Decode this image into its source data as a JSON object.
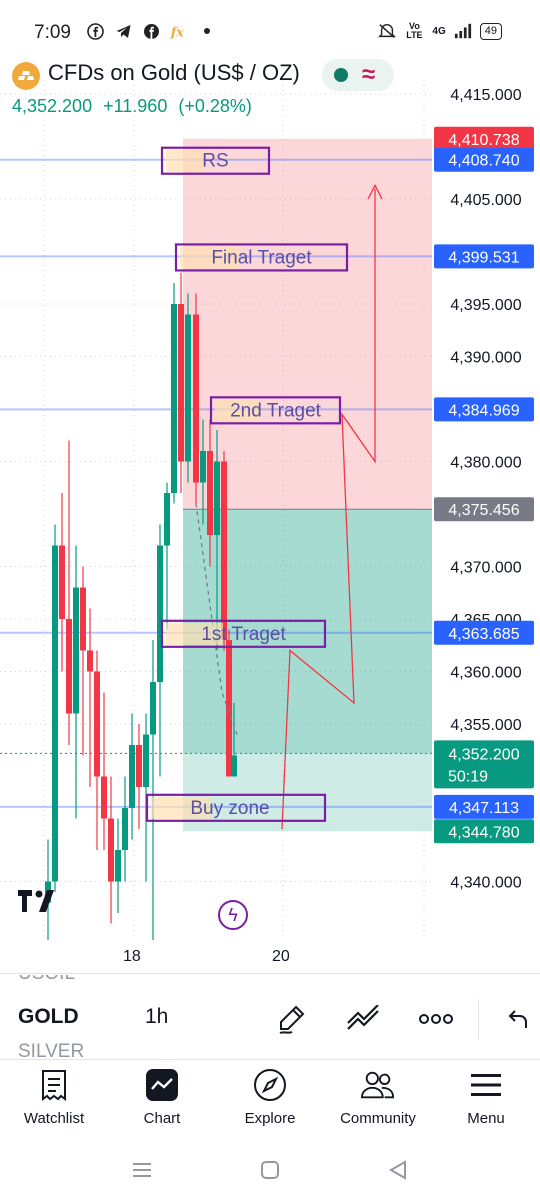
{
  "status_bar": {
    "time": "7:09",
    "battery": "49",
    "network": "4G",
    "volte": "Vo LTE"
  },
  "header": {
    "title": "CFDs on Gold (US$ / OZ)",
    "price": "4,352.200",
    "change": "+11.960",
    "change_pct": "(+0.28%)",
    "up_color": "#089981"
  },
  "chart": {
    "axis_ticks": [
      "4,415.000",
      "4,405.000",
      "4,395.000",
      "4,390.000",
      "4,380.000",
      "4,370.000",
      "4,365.000",
      "4,360.000",
      "4,355.000",
      "4,340.000"
    ],
    "axis_tick_values": [
      4415,
      4405,
      4395,
      4390,
      4380,
      4370,
      4365,
      4360,
      4355,
      4340
    ],
    "price_tags": [
      {
        "label": "4,410.738",
        "value": 4410.738,
        "color": "#f23645"
      },
      {
        "label": "4,408.740",
        "value": 4408.74,
        "color": "#2962ff"
      },
      {
        "label": "4,399.531",
        "value": 4399.531,
        "color": "#2962ff"
      },
      {
        "label": "4,384.969",
        "value": 4384.969,
        "color": "#2962ff"
      },
      {
        "label": "4,375.456",
        "value": 4375.456,
        "color": "#787b86"
      },
      {
        "label": "4,363.685",
        "value": 4363.685,
        "color": "#2962ff"
      },
      {
        "label": "4,347.113",
        "value": 4347.113,
        "color": "#2962ff"
      },
      {
        "label": "4,344.780",
        "value": 4344.78,
        "color": "#089981"
      }
    ],
    "last_price": {
      "label": "4,352.200",
      "countdown": "50:19",
      "value": 4352.2,
      "color": "#089981"
    },
    "annotations": [
      {
        "text": "RS",
        "value": 4408.74
      },
      {
        "text": "Final Traget",
        "value": 4399.531
      },
      {
        "text": "2nd Traget",
        "value": 4384.969
      },
      {
        "text": "1st Traget",
        "value": 4363.685
      },
      {
        "text": "Buy zone",
        "value": 4347.113
      }
    ],
    "position": {
      "stop": 4410.738,
      "entry": 4375.456,
      "target": 4344.78
    },
    "candle_color_up": "#089981",
    "candle_color_down": "#f23645",
    "x_labels": [
      "18",
      "20"
    ]
  },
  "toolbar": {
    "symbol_prev": "USOIL",
    "symbol": "GOLD",
    "symbol_next": "SILVER",
    "interval": "1h",
    "tools": [
      "pencil-icon",
      "trend-icon",
      "more-icon",
      "undo-icon"
    ]
  },
  "bottom_nav": {
    "items": [
      {
        "label": "Watchlist",
        "icon": "watchlist-icon"
      },
      {
        "label": "Chart",
        "icon": "chart-icon"
      },
      {
        "label": "Explore",
        "icon": "compass-icon"
      },
      {
        "label": "Community",
        "icon": "community-icon"
      },
      {
        "label": "Menu",
        "icon": "menu-icon"
      }
    ]
  }
}
